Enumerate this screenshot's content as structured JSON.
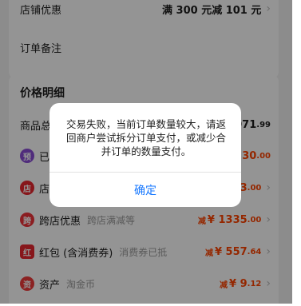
{
  "store_discount": {
    "label": "店铺优惠",
    "value": "满 300 元减 101 元"
  },
  "order_note": {
    "label": "订单备注"
  },
  "price_detail": {
    "title": "价格明细",
    "goods_total": {
      "label": "商品总",
      "value_int": "071",
      "value_dec": ".99"
    },
    "rows": [
      {
        "icon_text": "预",
        "icon_color": "#8a4dd6",
        "label": "已",
        "value_int": "30",
        "value_dec": ".00"
      },
      {
        "icon_text": "店",
        "icon_color": "#e8272f",
        "label": "店",
        "value_int": "93",
        "value_dec": ".00"
      },
      {
        "icon_text": "跨",
        "icon_color": "#f0333a",
        "label": "跨店优惠",
        "sub": "跨店满减等",
        "minus": "减",
        "value_int": "¥ 1335",
        "value_dec": ".00"
      },
      {
        "icon_text": "红",
        "icon_color": "#e8272f",
        "label": "红包 (含消费券)",
        "sub": "消费券已抵",
        "minus": "减",
        "value_int": "¥ 557",
        "value_dec": ".64"
      },
      {
        "icon_text": "资",
        "icon_color": "#f03c3c",
        "label": "资产",
        "sub": "淘金币",
        "minus": "减",
        "value_int": "¥ 9",
        "value_dec": ".12"
      }
    ]
  },
  "dialog": {
    "message": "交易失败，当前订单数量较大，请返回商户尝试拆分订单支付，或减少合并订单的数量支付。",
    "confirm_label": "确定",
    "accent": "#1677ff"
  }
}
